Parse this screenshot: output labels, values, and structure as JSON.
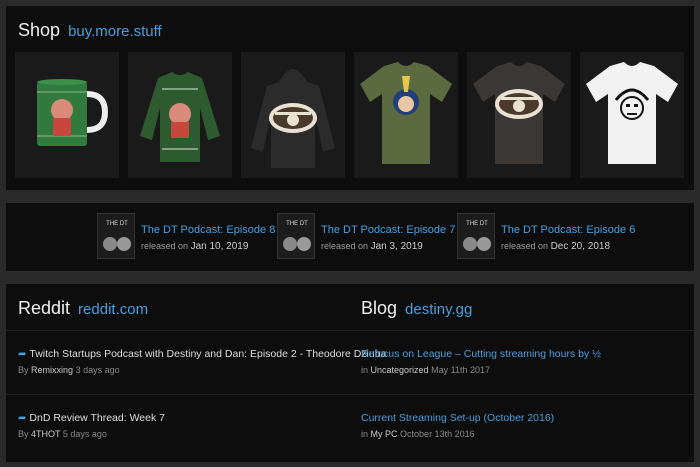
{
  "shop": {
    "title": "Shop",
    "link": "buy.more.stuff",
    "products": [
      {
        "name": "mug",
        "color": "#2f7a3c"
      },
      {
        "name": "sweatshirt",
        "color": "#2d5a2e"
      },
      {
        "name": "hoodie",
        "color": "#2b2b2b"
      },
      {
        "name": "olive-tee",
        "color": "#5b6b3f"
      },
      {
        "name": "grey-tee",
        "color": "#3a3735"
      },
      {
        "name": "white-tee",
        "color": "#f2f2f2"
      }
    ]
  },
  "podcasts": [
    {
      "title": "The DT Podcast: Episode 8",
      "prefix": "released on",
      "date": "Jan 10, 2019"
    },
    {
      "title": "The DT Podcast: Episode 7",
      "prefix": "released on",
      "date": "Jan 3, 2019"
    },
    {
      "title": "The DT Podcast: Episode 6",
      "prefix": "released on",
      "date": "Dec 20, 2018"
    }
  ],
  "reddit": {
    "title": "Reddit",
    "link": "reddit.com",
    "posts": [
      {
        "title": "Twitch Startups Podcast with Destiny and Dan: Episode 2 - Theodore Dziuba",
        "by": "By",
        "author": "Remixxing",
        "time": "3 days ago"
      },
      {
        "title": "DnD Review Thread: Week 7",
        "by": "By",
        "author": "4THOT",
        "time": "5 days ago"
      }
    ]
  },
  "blog": {
    "title": "Blog",
    "link": "destiny.gg",
    "posts": [
      {
        "title": "Refocus on League – Cutting streaming hours by ½",
        "in": "in",
        "category": "Uncategorized",
        "date": "May 11th 2017"
      },
      {
        "title": "Current Streaming Set-up (October 2016)",
        "in": "in",
        "category": "My PC",
        "date": "October 13th 2016"
      }
    ]
  },
  "colors": {
    "accent": "#4a9fe0",
    "panel": "#0d0d0d",
    "page": "#2a2a2a"
  }
}
